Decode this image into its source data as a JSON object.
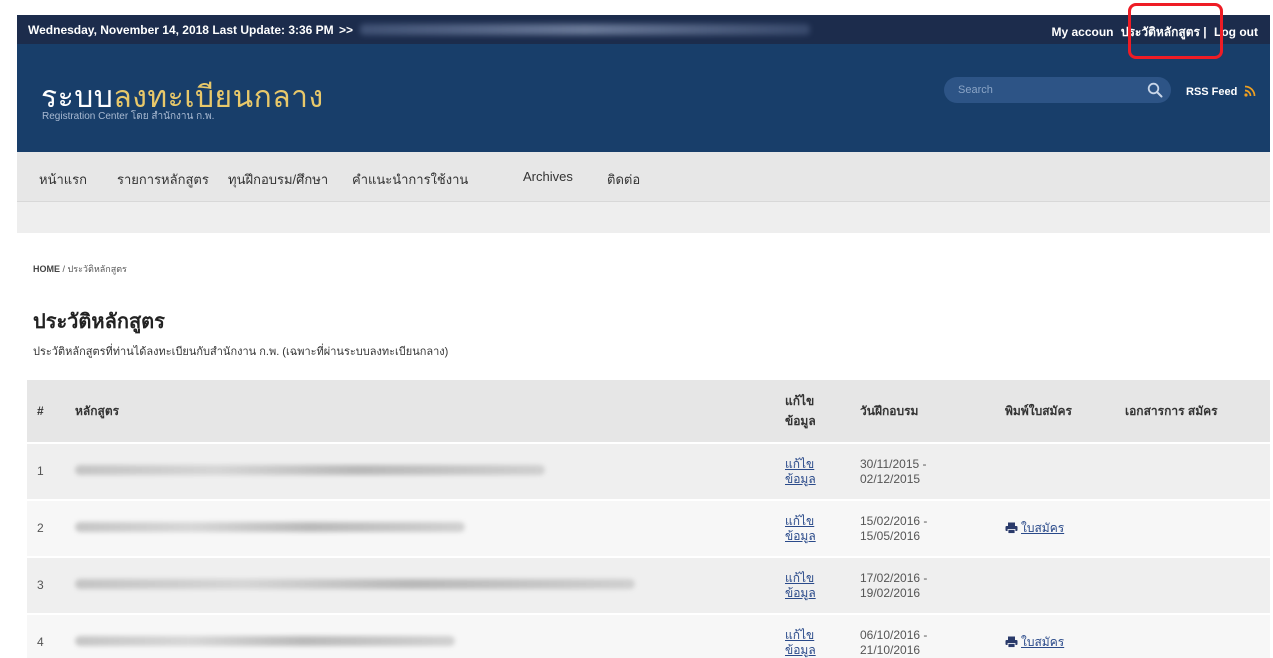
{
  "topbar": {
    "date_text": "Wednesday, November 14, 2018 Last Update: 3:36 PM",
    "arrow": ">>",
    "my_account": "My accoun",
    "course_history": "ประวัติหลักสูตร |",
    "logout": "Log out"
  },
  "header": {
    "logo_part1": "ระบบ",
    "logo_part2": "ลงทะเบียนกลาง",
    "logo_sub": "Registration Center โดย สำนักงาน ก.พ.",
    "search_placeholder": "Search",
    "search_icon": "search-icon",
    "rss_label": "RSS Feed",
    "rss_icon": "rss-icon"
  },
  "nav": {
    "items": [
      "หน้าแรก",
      "รายการหลักสูตร",
      "ทุนฝึกอบรม/ศึกษา",
      "คำแนะนำการใช้งาน",
      "Archives",
      "ติดต่อ"
    ]
  },
  "breadcrumb": {
    "home": "HOME",
    "separator": "/",
    "current": "ประวัติหลักสูตร"
  },
  "page": {
    "title": "ประวัติหลักสูตร",
    "subtitle": "ประวัติหลักสูตรที่ท่านได้ลงทะเบียนกับสำนักงาน ก.พ. (เฉพาะที่ผ่านระบบลงทะเบียนกลาง)"
  },
  "table": {
    "headers": {
      "num": "#",
      "course": "หลักสูตร",
      "edit": "แก้ไข ข้อมูล",
      "date": "วันฝึกอบรม",
      "print": "พิมพ์ใบสมัคร",
      "docs": "เอกสารการ สมัคร"
    },
    "rows": [
      {
        "num": "1",
        "edit": "แก้ไข ข้อมูล",
        "date": "30/11/2015 - 02/12/2015",
        "print": ""
      },
      {
        "num": "2",
        "edit": "แก้ไข ข้อมูล",
        "date": "15/02/2016 - 15/05/2016",
        "print": "ใบสมัคร"
      },
      {
        "num": "3",
        "edit": "แก้ไข ข้อมูล",
        "date": "17/02/2016 - 19/02/2016",
        "print": ""
      },
      {
        "num": "4",
        "edit": "แก้ไข ข้อมูล",
        "date": "06/10/2016 - 21/10/2016",
        "print": "ใบสมัคร"
      }
    ]
  },
  "colors": {
    "topbar_bg": "#1c2c4c",
    "header_bg": "#183e6a",
    "logo_accent": "#e8c86a",
    "highlight": "#ee1c25"
  }
}
